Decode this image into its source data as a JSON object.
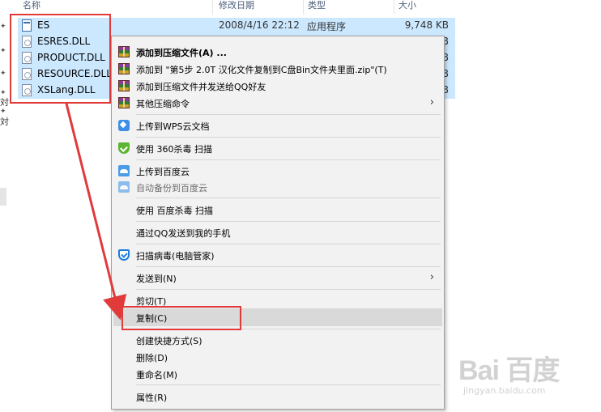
{
  "columns": {
    "name": "名称",
    "date": "修改日期",
    "type": "类型",
    "size": "大小"
  },
  "nav": {
    "fragment_1": "対",
    "fragment_2": "対"
  },
  "files": [
    {
      "name": "ES",
      "date": "2008/4/16 22:12",
      "type": "应用程序",
      "size": "9,748 KB",
      "icon": "exe-icon"
    },
    {
      "name": "ESRES.DLL",
      "size_tail": "B",
      "icon": "dll-icon"
    },
    {
      "name": "PRODUCT.DLL",
      "size_tail": "B",
      "icon": "dll-icon"
    },
    {
      "name": "RESOURCE.DLL",
      "size_tail": "B",
      "icon": "dll-icon"
    },
    {
      "name": "XSLang.DLL",
      "size_tail": "B",
      "icon": "dll-icon"
    }
  ],
  "menu": {
    "add_archive": "添加到压缩文件(A) ...",
    "add_to_zip": "添加到 \"第5步 2.0T 汉化文件复制到C盘Bin文件夹里面.zip\"(T)",
    "add_and_send_qq": "添加到压缩文件并发送给QQ好友",
    "other_compress": "其他压缩命令",
    "upload_wps": "上传到WPS云文档",
    "scan_360": "使用 360杀毒 扫描",
    "upload_baidu": "上传到百度云",
    "auto_backup_baidu": "自动备份到百度云",
    "scan_baidu": "使用 百度杀毒 扫描",
    "send_qq_phone": "通过QQ发送到我的手机",
    "scan_tencent": "扫描病毒(电脑管家)",
    "send_to": "发送到(N)",
    "cut": "剪切(T)",
    "copy": "复制(C)",
    "create_shortcut": "创建快捷方式(S)",
    "delete": "删除(D)",
    "rename": "重命名(M)",
    "properties": "属性(R)",
    "submenu_arrow": "›"
  },
  "watermark": {
    "logo": "Bai 百度",
    "url": "jingyan.baidu.com"
  },
  "colors": {
    "selection": "#cce8ff",
    "annotation": "#e03a3a",
    "menu_bg": "#f2f2f2",
    "hover": "#d9d9d9"
  }
}
